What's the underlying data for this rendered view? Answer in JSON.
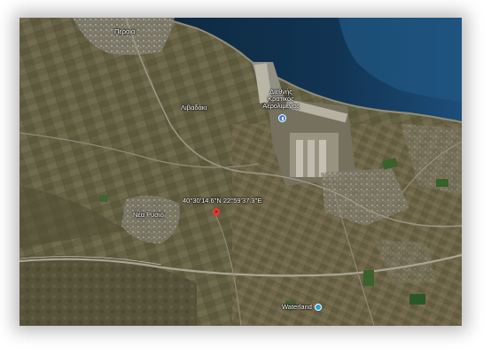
{
  "map": {
    "view": "satellite",
    "labels": {
      "perea": "Περαία",
      "airport_line1": "Διεθνής",
      "airport_line2": "Κρατικός",
      "airport_line3": "Αερολιμένας",
      "livadaki": "Λιβαδάκι",
      "coordinates": "40°30'14.6\"N 22°59'37.3\"E",
      "nea_rysio": "Νέα Ρυσιό",
      "waterland": "Waterland"
    },
    "icons": {
      "pin": "map-pin-icon",
      "airport": "airport-icon",
      "poi": "water-park-icon"
    },
    "colors": {
      "sea_deep": "#0d2f4d",
      "sea_shallow": "#1e4f78",
      "land": "#6f6a4a",
      "pin": "#e53935"
    }
  }
}
